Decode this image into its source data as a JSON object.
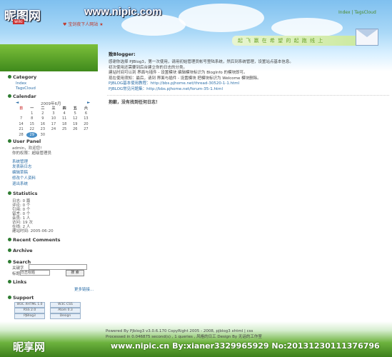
{
  "header": {
    "logo_text": "昵图网",
    "logo_sub": "wiki",
    "site_url": "www.nipic.com",
    "tagline": "♥ 宝剑夜下人网站 ★",
    "nav_index": "Index",
    "nav_sep": " | ",
    "nav_tagcloud": "TagsCloud",
    "slogan": "起 飞 赢 在 希 望 的 起 跑 线 上"
  },
  "sidebar": {
    "category": {
      "title": "Category",
      "items": [
        "Index",
        "TagsCloud"
      ]
    },
    "calendar": {
      "title": "Calendar",
      "month_label": "2009年6月",
      "prev": "◄",
      "next": "►",
      "weekdays": [
        "日",
        "一",
        "二",
        "三",
        "四",
        "五",
        "六"
      ],
      "weeks": [
        [
          "",
          "1",
          "2",
          "3",
          "4",
          "5",
          "6"
        ],
        [
          "7",
          "8",
          "9",
          "10",
          "11",
          "12",
          "13"
        ],
        [
          "14",
          "15",
          "16",
          "17",
          "18",
          "19",
          "20"
        ],
        [
          "21",
          "22",
          "23",
          "24",
          "25",
          "26",
          "27"
        ],
        [
          "28",
          "29",
          "30",
          "",
          "",
          "",
          ""
        ]
      ],
      "today": "29"
    },
    "user_panel": {
      "title": "User Panel",
      "welcome": "admin，欢迎您!",
      "role": "你的权限：超级管理员",
      "links": [
        "系统管理",
        "发表新日志",
        "编辑草稿",
        "修改个人资料",
        "退出系统"
      ]
    },
    "statistics": {
      "title": "Statistics",
      "lines": [
        "日志: 0 篇",
        "评论: 0 个",
        "引用: 0 个",
        "留言: 0 个",
        "会员: 1 人",
        "访问: 19 次",
        "在线: 2 人",
        "建站时间: 2005-06-20"
      ]
    },
    "recent_comments": {
      "title": "Recent Comments"
    },
    "archive": {
      "title": "Archive"
    },
    "search": {
      "title": "Search",
      "keyword_label": "关键字",
      "scope_title": "标题",
      "scope_all": "日志标题",
      "button": "搜 索"
    },
    "links": {
      "title": "Links",
      "more": "更多链接..."
    },
    "support": {
      "title": "Support",
      "badges": [
        "W3C XHTML 1.0",
        "W3C CSS",
        "RSS 2.0",
        "Atom 0.3",
        "PJBlog3",
        "Design"
      ]
    }
  },
  "main": {
    "greeting": "致Blogger:",
    "lines": [
      "感谢你选择 PJBlog3，第一次使用，请用初始管理员帐号登陆系统，然后到系统管理，设置站点基本信息。",
      "初次使用还需要到后台建立你的日志的分类。",
      "建站时间可以到 界面与插件 - 设置模块 编辑模块标识为 BlogInfo 的模块即可。",
      "",
      "现在使用须知：最后，请到 界面与插件 - 设置模块 把模块标识为 Welcome 模块删除。",
      "PJBLOG基本使用教程：http://bbs.pjhome.net/thread-30520-1-1.html",
      "PJBLOG常见问题集：http://bbs.pjhome.net/forum-35-1.html"
    ],
    "no_log": "抱歉，没有找到任何日志！"
  },
  "footer": {
    "line1": "Powered By PJblog3 v3.0.6.170 CopyRight 2005 - 2008, pjblog3 xhtml | css",
    "line2": "Processed in 0.046875 second(s) , 1 queries , 风格的日工 Design By 无话的工作室",
    "watermark_left": "昵享网",
    "watermark_right": "www.nipic.cn  By:xianer3329965929  No:20131230111376796"
  },
  "colors": {
    "link": "#2d6fa8",
    "sky_top": "#7fc0ef",
    "grass": "#3f8a1c",
    "section_icon": "#2f7d32"
  }
}
